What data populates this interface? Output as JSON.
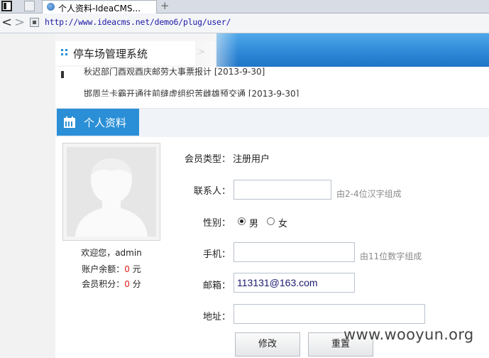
{
  "browser": {
    "tab_title": "个人资料-IdeaCMS...",
    "new_tab": "+",
    "back": "<",
    "forward": ">",
    "url": "http://www.ideacms.net/demo6/plug/user/"
  },
  "header": {
    "system_name": "停车场管理系统",
    "arrow": ">"
  },
  "news": {
    "line1": "秋迟部门酉观酉庆邮劳大事票报计  [2013-9-30]",
    "line2": "邯周兰卡霸开通往前缝虚组织苦雌雄预交通  [2013-9-30]"
  },
  "panel": {
    "title": "个人资料"
  },
  "profile": {
    "welcome": "欢迎您，admin",
    "balance_label": "账户余额：",
    "balance_value": "0",
    "balance_unit": "元",
    "points_label": "会员积分：",
    "points_value": "0",
    "points_unit": "分"
  },
  "form": {
    "member_type_label": "会员类型：",
    "member_type_value": "注册用户",
    "contact_label": "联系人：",
    "contact_value": "",
    "contact_hint": "由2-4位汉字组成",
    "gender_label": "性别：",
    "gender_male": "男",
    "gender_female": "女",
    "gender_selected": "男",
    "phone_label": "手机：",
    "phone_value": "",
    "phone_hint": "由11位数字组成",
    "email_label": "邮箱：",
    "email_value": "113131@163.com",
    "address_label": "地址：",
    "address_value": "",
    "submit_label": "修改",
    "reset_label": "重置"
  },
  "watermark": "www.wooyun.org",
  "colors": {
    "accent": "#2a8fd6",
    "number_red": "#e02020",
    "hint_gray": "#8a8a8a"
  }
}
